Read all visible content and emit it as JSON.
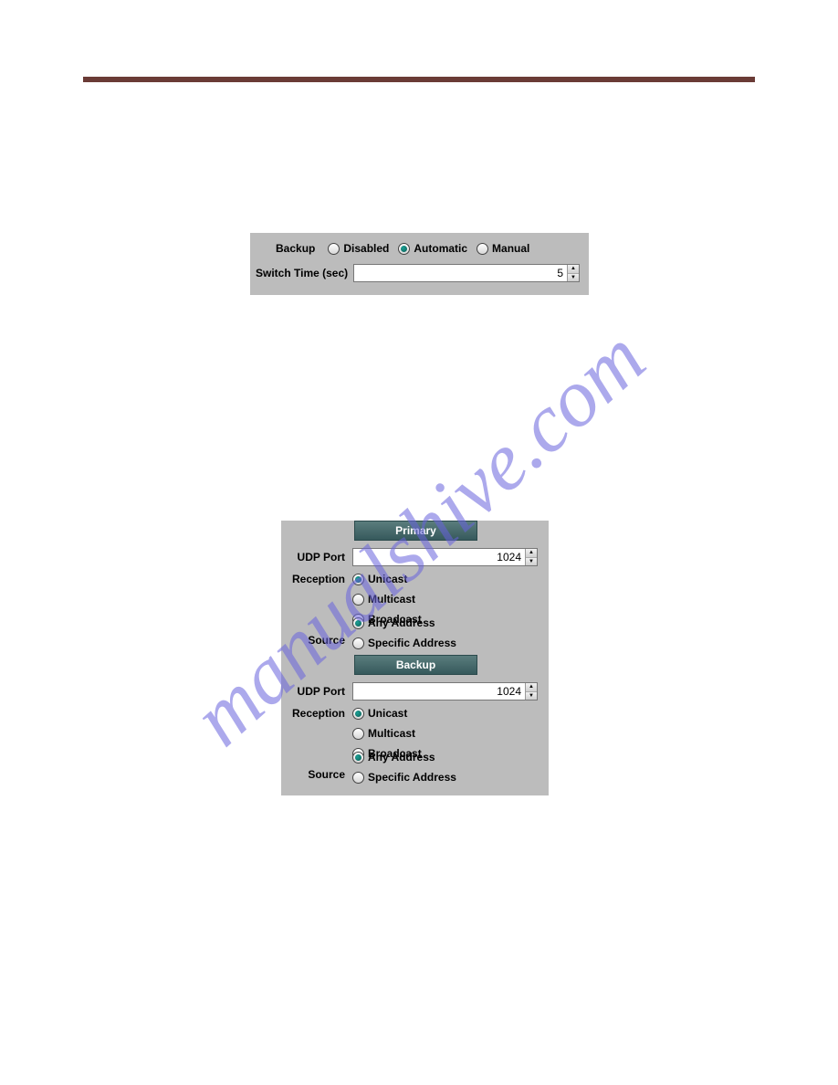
{
  "watermark": "manualshive.com",
  "panel1": {
    "backup_label": "Backup",
    "disabled": "Disabled",
    "automatic": "Automatic",
    "manual": "Manual",
    "switch_time_label": "Switch Time (sec)",
    "switch_time_value": "5"
  },
  "panel2": {
    "primary_header": "Primary",
    "backup_header": "Backup",
    "udp_port_label": "UDP Port",
    "reception_label": "Reception",
    "source_label": "Source",
    "udp_port_primary": "1024",
    "udp_port_backup": "1024",
    "unicast": "Unicast",
    "multicast": "Multicast",
    "broadcast": "Broadcast",
    "any_address": "Any Address",
    "specific_address": "Specific Address"
  }
}
